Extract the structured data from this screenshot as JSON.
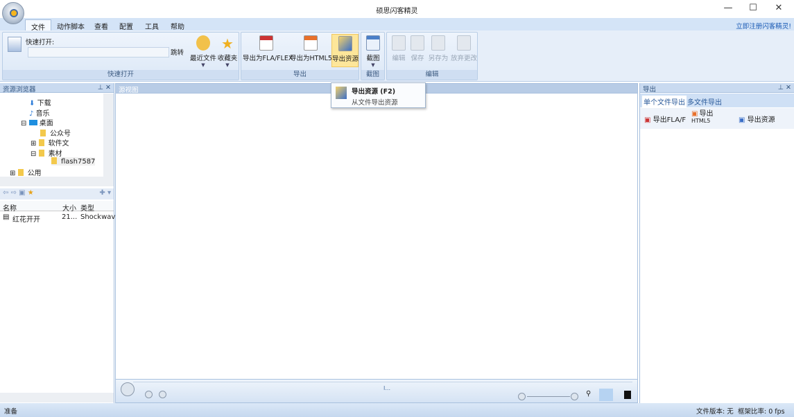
{
  "window": {
    "title": "硕思闪客精灵",
    "min": "—",
    "max": "☐",
    "close": "✕"
  },
  "tabs": [
    "文件",
    "动作脚本",
    "查看",
    "配置",
    "工具",
    "帮助"
  ],
  "register_link": "立即注册闪客精灵!",
  "ribbon": {
    "quick_open": {
      "label": "快速打开:",
      "input_value": "",
      "jump": "跳转",
      "recent": "最近文件",
      "favorites": "收藏夹",
      "group": "快速打开"
    },
    "export": {
      "fla": "导出为FLA/FLEX",
      "html5": "导出为HTML5",
      "resources": "导出资源",
      "group": "导出"
    },
    "screenshot": {
      "label": "截图",
      "group": "截图"
    },
    "edit": {
      "edit": "编辑",
      "save": "保存",
      "save_as": "另存为",
      "discard": "放弃更改",
      "group": "编辑"
    }
  },
  "tooltip": {
    "title": "导出资源 (F2)",
    "desc": "从文件导出资源"
  },
  "explorer": {
    "title": "资源浏览器",
    "tree": [
      "下载",
      "音乐",
      "桌面",
      "公众号",
      "软件文",
      "素材",
      "flash7587",
      "公用"
    ]
  },
  "file_list": {
    "columns": [
      "名称",
      "大小",
      "类型"
    ],
    "rows": [
      {
        "name": "红花开开",
        "size": "21...",
        "type": "Shockwav"
      }
    ]
  },
  "source_view": {
    "title": "源视图"
  },
  "export_panel": {
    "title": "导出",
    "tabs": [
      "单个文件导出",
      "多文件导出"
    ],
    "buttons": [
      "导出FLA/F",
      "导出",
      "HTML5",
      "导出资源"
    ]
  },
  "player": {
    "frame": "I..."
  },
  "status": {
    "left": "准备",
    "version": "文件版本: 无",
    "fps": "框架比率: 0 fps"
  }
}
